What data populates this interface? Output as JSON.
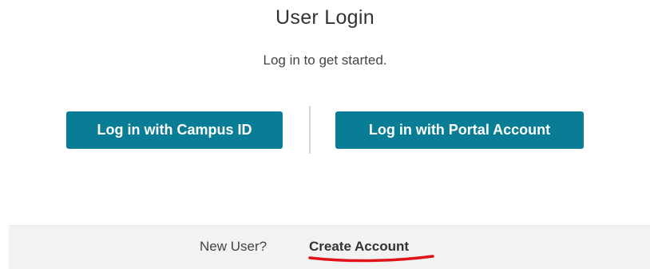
{
  "header": {
    "title": "User Login",
    "subtitle": "Log in to get started."
  },
  "login_options": {
    "campus_id_label": "Log in with Campus ID",
    "portal_account_label": "Log in with Portal Account"
  },
  "footer": {
    "prompt": "New User?",
    "create_account_label": "Create Account"
  },
  "colors": {
    "button_bg": "#0a7d96",
    "button_text": "#ffffff",
    "footer_bg": "#f2f2f2",
    "annotation": "#e0131a"
  }
}
